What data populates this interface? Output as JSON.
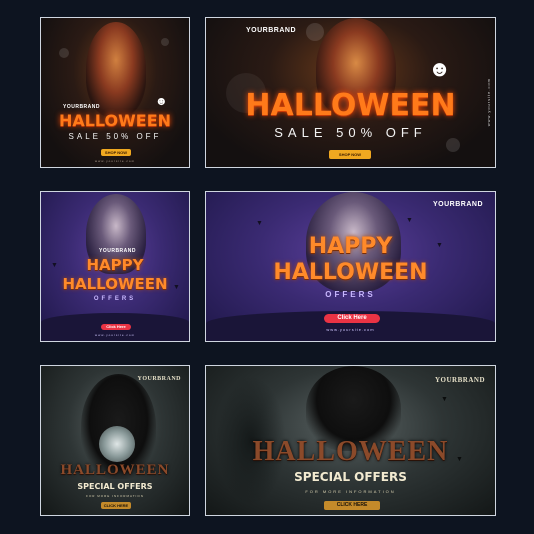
{
  "cards": {
    "c1": {
      "brand": "YOURBRAND",
      "title": "HALLOWEEN",
      "subtitle": "SALE 50% OFF",
      "button": "SHOP NOW",
      "url": "www.yoursite.com"
    },
    "c2": {
      "brand": "YOURBRAND",
      "title": "HALLOWEEN",
      "subtitle": "SALE 50% OFF",
      "button": "SHOP NOW",
      "url": "www.yoursite.com"
    },
    "c3": {
      "brand": "YOURBRAND",
      "title_line1": "HAPPY",
      "title_line2": "HALLOWEEN",
      "offers": "OFFERS",
      "button": "Click Here",
      "url": "www.yoursite.com"
    },
    "c4": {
      "brand": "YOURBRAND",
      "title_line1": "HAPPY",
      "title_line2": "HALLOWEEN",
      "offers": "OFFERS",
      "button": "Click Here",
      "url": "www.yoursite.com"
    },
    "c5": {
      "brand": "YOURBRAND",
      "title": "HALLOWEEN",
      "special": "SPECIAL OFFERS",
      "info": "FOR MORE INFORMATION",
      "button": "CLICK HERE"
    },
    "c6": {
      "brand": "YOURBRAND",
      "title": "HALLOWEEN",
      "special": "SPECIAL OFFERS",
      "info": "FOR MORE INFORMATION",
      "button": "CLICK HERE"
    }
  },
  "colors": {
    "page_background": "#0d1420",
    "orange_title": "#ff7a1a",
    "orange_button": "#f0a820",
    "purple_background": "#3a2a72",
    "red_button": "#ea3344",
    "gold_button": "#c48a2a"
  },
  "icons": {
    "pumpkin": "pumpkin-icon",
    "bat": "bat-icon"
  }
}
